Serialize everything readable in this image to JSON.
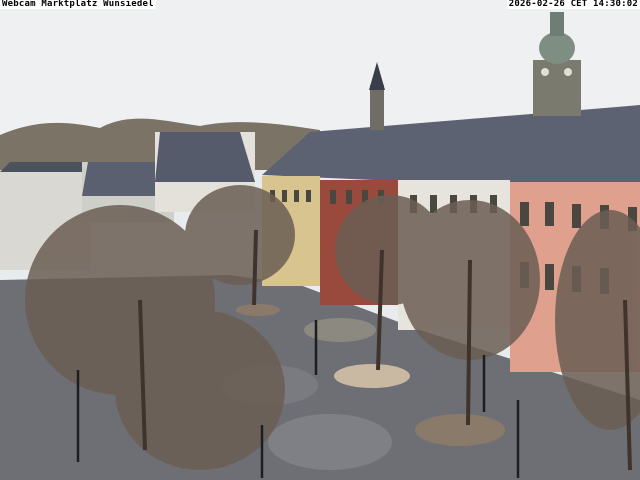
{
  "overlay": {
    "title": "Webcam Marktplatz Wunsiedel",
    "timestamp": "2026-02-26 CET 14:30:02"
  },
  "colors": {
    "sky": "#eef0f2",
    "roof": "#5c6272",
    "facade_yellow": "#d8c48e",
    "facade_red": "#9a4a3c",
    "facade_white": "#e6e4dc",
    "facade_pink": "#dfa08e",
    "pavement": "#6e6f74",
    "tree": "#6b5e54",
    "tower": "#7a7a6e",
    "copper_dome": "#7e8e82"
  }
}
